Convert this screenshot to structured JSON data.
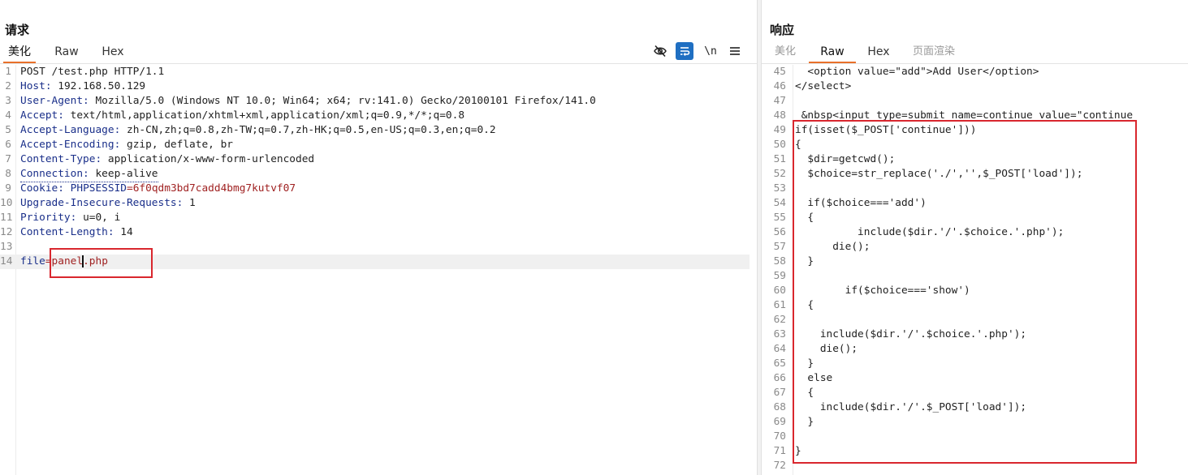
{
  "request": {
    "title": "请求",
    "tabs": [
      "美化",
      "Raw",
      "Hex"
    ],
    "active_tab": "美化",
    "toolbar": {
      "icons": [
        "eye-slash-icon",
        "wrap-lines-icon",
        "newline-toggle-icon",
        "menu-icon"
      ],
      "newline_label": "\\n"
    },
    "lines": [
      {
        "num": "1",
        "text": "POST /test.php HTTP/1.1"
      },
      {
        "num": "2",
        "key": "Host",
        "value": "192.168.50.129"
      },
      {
        "num": "3",
        "key": "User-Agent",
        "value": "Mozilla/5.0 (Windows NT 10.0; Win64; x64; rv:141.0) Gecko/20100101 Firefox/141.0"
      },
      {
        "num": "4",
        "key": "Accept",
        "value": "text/html,application/xhtml+xml,application/xml;q=0.9,*/*;q=0.8"
      },
      {
        "num": "5",
        "key": "Accept-Language",
        "value": "zh-CN,zh;q=0.8,zh-TW;q=0.7,zh-HK;q=0.5,en-US;q=0.3,en;q=0.2"
      },
      {
        "num": "6",
        "key": "Accept-Encoding",
        "value": "gzip, deflate, br"
      },
      {
        "num": "7",
        "key": "Content-Type",
        "value": "application/x-www-form-urlencoded"
      },
      {
        "num": "8",
        "key": "Connection",
        "value": "keep-alive"
      },
      {
        "num": "9",
        "key": "Cookie",
        "cookie_name": "PHPSESSID",
        "cookie_value": "6f0qdm3bd7cadd4bmg7kutvf07"
      },
      {
        "num": "10",
        "key": "Upgrade-Insecure-Requests",
        "value": "1"
      },
      {
        "num": "11",
        "key": "Priority",
        "value": "u=0, i"
      },
      {
        "num": "12",
        "key": "Content-Length",
        "value": "14"
      },
      {
        "num": "13",
        "text": ""
      },
      {
        "num": "14",
        "param_name": "file",
        "param_value_a": "panel",
        "param_value_b": ".php"
      }
    ]
  },
  "response": {
    "title": "响应",
    "tabs": [
      "美化",
      "Raw",
      "Hex",
      "页面渲染"
    ],
    "active_tab": "Raw",
    "lines": [
      {
        "num": "45",
        "text": "  <option value=\"add\">Add User</option>"
      },
      {
        "num": "46",
        "text": "</select>"
      },
      {
        "num": "47",
        "text": ""
      },
      {
        "num": "48",
        "text": " &nbsp<input type=submit name=continue value=\"continue"
      },
      {
        "num": "49",
        "text": "if(isset($_POST['continue']))"
      },
      {
        "num": "50",
        "text": "{"
      },
      {
        "num": "51",
        "text": "  $dir=getcwd();"
      },
      {
        "num": "52",
        "text": "  $choice=str_replace('./','',$_POST['load']);"
      },
      {
        "num": "53",
        "text": ""
      },
      {
        "num": "54",
        "text": "  if($choice==='add')"
      },
      {
        "num": "55",
        "text": "  {"
      },
      {
        "num": "56",
        "text": "          include($dir.'/'.$choice.'.php');"
      },
      {
        "num": "57",
        "text": "      die();"
      },
      {
        "num": "58",
        "text": "  }"
      },
      {
        "num": "59",
        "text": ""
      },
      {
        "num": "60",
        "text": "        if($choice==='show')"
      },
      {
        "num": "61",
        "text": "  {"
      },
      {
        "num": "62",
        "text": ""
      },
      {
        "num": "63",
        "text": "    include($dir.'/'.$choice.'.php');"
      },
      {
        "num": "64",
        "text": "    die();"
      },
      {
        "num": "65",
        "text": "  }"
      },
      {
        "num": "66",
        "text": "  else"
      },
      {
        "num": "67",
        "text": "  {"
      },
      {
        "num": "68",
        "text": "    include($dir.'/'.$_POST['load']);"
      },
      {
        "num": "69",
        "text": "  }"
      },
      {
        "num": "70",
        "text": ""
      },
      {
        "num": "71",
        "text": "}"
      },
      {
        "num": "72",
        "text": ""
      }
    ]
  },
  "colors": {
    "accent_tab": "#e8702a",
    "header_key": "#1a2f8a",
    "param_value": "#a02222",
    "highlight_box": "#d9272e",
    "wrap_button_bg": "#1f6fc2"
  }
}
